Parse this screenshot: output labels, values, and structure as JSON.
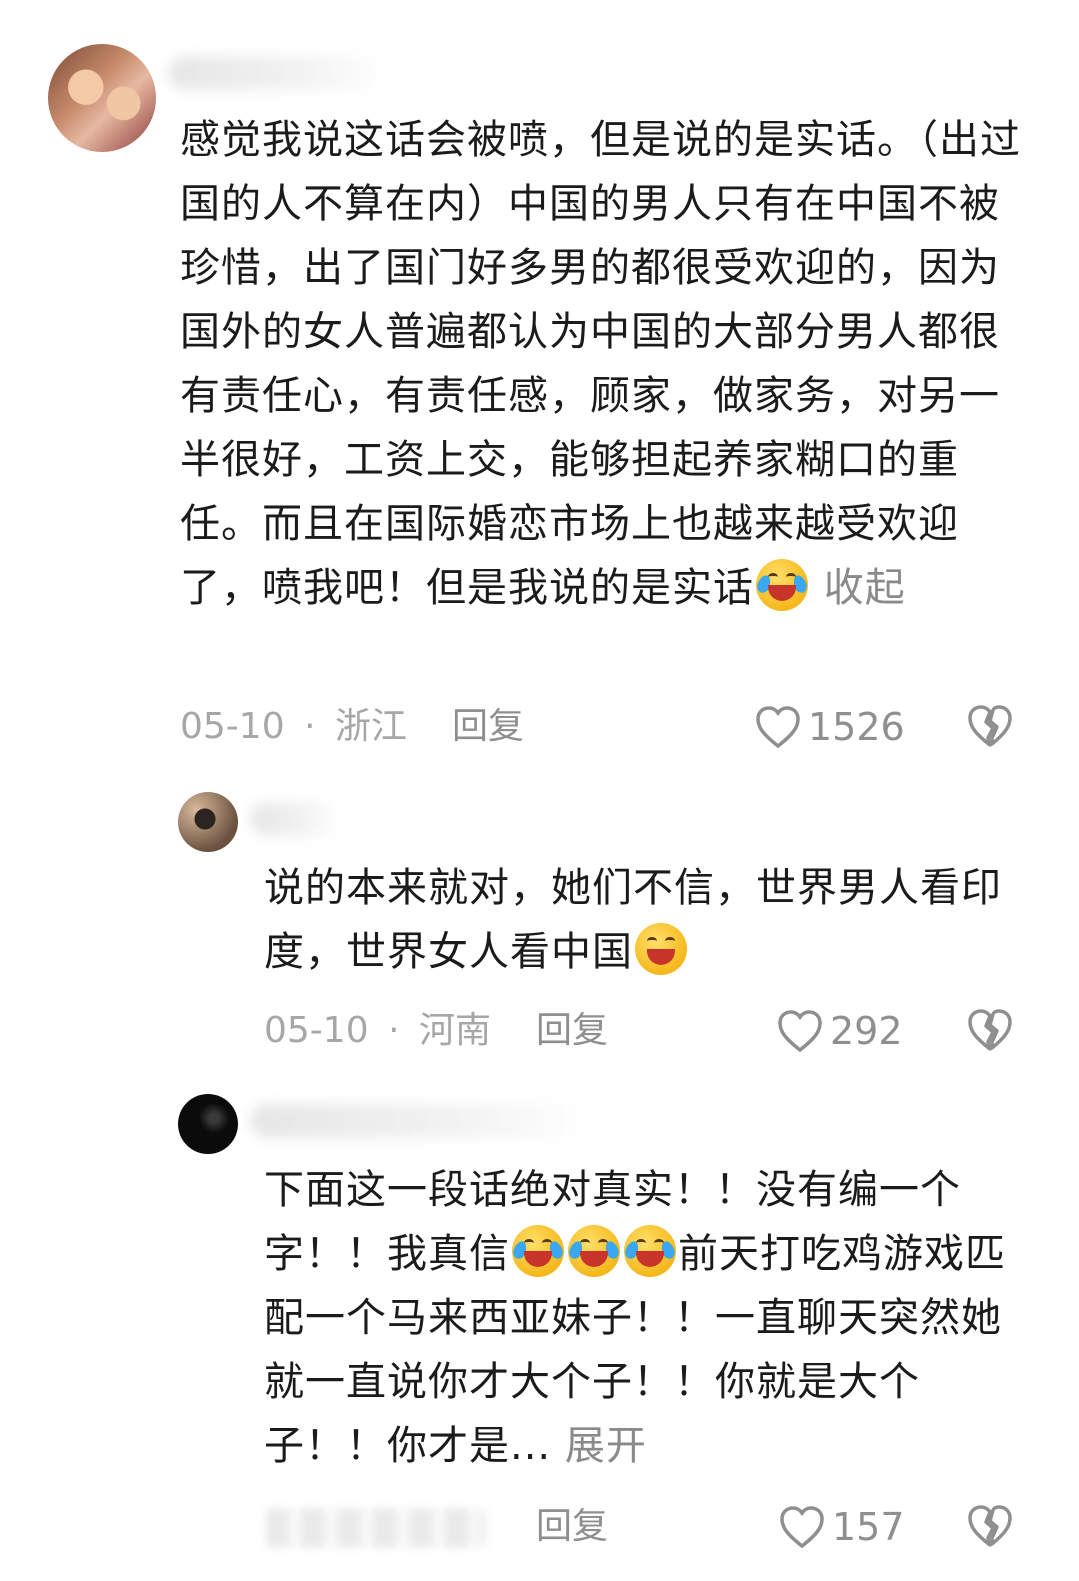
{
  "comments": [
    {
      "text": "感觉我说这话会被喷，但是说的是实话。（出过国的人不算在内）中国的男人只有在中国不被珍惜，出了国门好多男的都很受欢迎的，因为国外的女人普遍都认为中国的大部分男人都很有责任心，有责任感，顾家，做家务，对另一半很好，工资上交，能够担起养家糊口的重任。而且在国际婚恋市场上也越来越受欢迎了，喷我吧！但是我说的是实话",
      "toggle": "收起",
      "date": "05-10",
      "separator": "·",
      "location": "浙江",
      "reply": "回复",
      "likes": "1526"
    },
    {
      "text": "说的本来就对，她们不信，世界男人看印度，世界女人看中国",
      "date": "05-10",
      "separator": "·",
      "location": "河南",
      "reply": "回复",
      "likes": "292"
    },
    {
      "text_a": "下面这一段话绝对真实！！没有编一个字！！我真信",
      "text_b": "前天打吃鸡游戏匹配一个马来西亚妹子！！一直聊天突然她就一直说你才大个子！！你就是大个子！！你才是...",
      "toggle": "展开",
      "reply": "回复",
      "likes": "157"
    }
  ],
  "icons": {
    "like": "heart-outline-icon",
    "dislike": "broken-heart-icon",
    "emoji_laugh": "laugh-cry-emoji",
    "emoji_grin": "grin-emoji"
  },
  "colors": {
    "text": "#1b1b1b",
    "meta": "#a7a7a7",
    "secondary": "#8f8f8f"
  }
}
